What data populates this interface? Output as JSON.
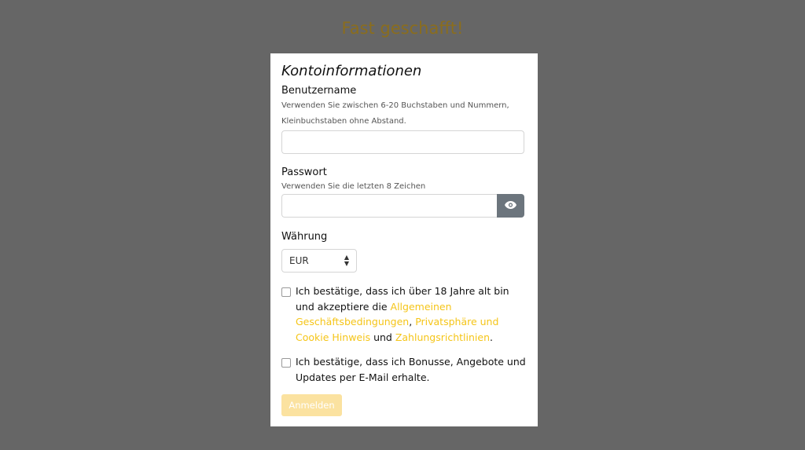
{
  "page": {
    "heading": "Fast geschafft!"
  },
  "form": {
    "title": "Kontoinformationen",
    "username": {
      "label": "Benutzername",
      "hint_line1": "Verwenden Sie zwischen 6-20 Buchstaben und Nummern,",
      "hint_line2": "Kleinbuchstaben ohne Abstand.",
      "value": "",
      "placeholder": ""
    },
    "password": {
      "label": "Passwort",
      "hint": "Verwenden Sie die letzten 8 Zeichen",
      "value": "",
      "placeholder": "",
      "toggle_icon": "eye-icon"
    },
    "currency": {
      "label": "Währung",
      "selected": "EUR"
    },
    "terms": {
      "text_before": "Ich bestätige, dass ich über 18 Jahre alt bin und akzeptiere die ",
      "link_terms": "Allgemeinen Geschäftsbedingungen",
      "sep1": ", ",
      "link_privacy": "Privatsphäre und Cookie Hinweis",
      "sep2": " und ",
      "link_payment": "Zahlungsrichtlinien",
      "end": ".",
      "checked": false
    },
    "marketing": {
      "text": "Ich bestätige, dass ich Bonusse, Angebote und Updates per E-Mail erhalte.",
      "checked": false
    },
    "submit_label": "Anmelden"
  },
  "colors": {
    "overlay": "#666666",
    "accent_link": "#f5c518",
    "button_disabled": "#fbe2a0",
    "eye_button": "#6c757d"
  }
}
